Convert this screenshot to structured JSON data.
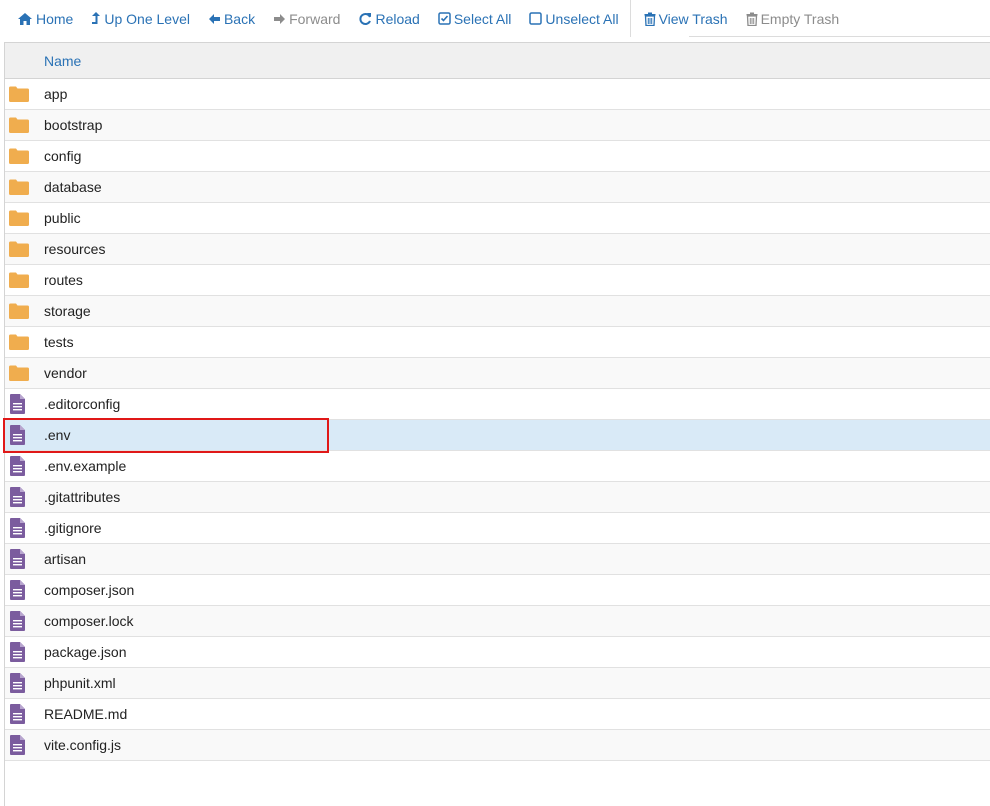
{
  "toolbar": {
    "buttons": [
      {
        "id": "home",
        "label": "Home",
        "icon": "home-icon",
        "enabled": true
      },
      {
        "id": "up",
        "label": "Up One Level",
        "icon": "level-up-icon",
        "enabled": true
      },
      {
        "id": "back",
        "label": "Back",
        "icon": "arrow-left-icon",
        "enabled": true
      },
      {
        "id": "forward",
        "label": "Forward",
        "icon": "arrow-right-icon",
        "enabled": false
      },
      {
        "id": "reload",
        "label": "Reload",
        "icon": "reload-icon",
        "enabled": true
      },
      {
        "id": "select_all",
        "label": "Select All",
        "icon": "checked-checkbox-icon",
        "enabled": true
      },
      {
        "id": "unselect_all",
        "label": "Unselect All",
        "icon": "empty-checkbox-icon",
        "enabled": true
      },
      {
        "id": "view_trash",
        "label": "View Trash",
        "icon": "trash-icon",
        "enabled": true
      },
      {
        "id": "empty_trash",
        "label": "Empty Trash",
        "icon": "trash-icon",
        "enabled": false
      }
    ]
  },
  "file_list": {
    "column_name": "Name",
    "items": [
      {
        "name": "app",
        "type": "folder"
      },
      {
        "name": "bootstrap",
        "type": "folder"
      },
      {
        "name": "config",
        "type": "folder"
      },
      {
        "name": "database",
        "type": "folder"
      },
      {
        "name": "public",
        "type": "folder"
      },
      {
        "name": "resources",
        "type": "folder"
      },
      {
        "name": "routes",
        "type": "folder"
      },
      {
        "name": "storage",
        "type": "folder"
      },
      {
        "name": "tests",
        "type": "folder"
      },
      {
        "name": "vendor",
        "type": "folder"
      },
      {
        "name": ".editorconfig",
        "type": "file"
      },
      {
        "name": ".env",
        "type": "file",
        "selected": true
      },
      {
        "name": ".env.example",
        "type": "file"
      },
      {
        "name": ".gitattributes",
        "type": "file"
      },
      {
        "name": ".gitignore",
        "type": "file"
      },
      {
        "name": "artisan",
        "type": "file"
      },
      {
        "name": "composer.json",
        "type": "file"
      },
      {
        "name": "composer.lock",
        "type": "file"
      },
      {
        "name": "package.json",
        "type": "file"
      },
      {
        "name": "phpunit.xml",
        "type": "file"
      },
      {
        "name": "README.md",
        "type": "file"
      },
      {
        "name": "vite.config.js",
        "type": "file"
      }
    ]
  },
  "colors": {
    "link_blue": "#2a72b5",
    "disabled_gray": "#8c8c8c",
    "folder_orange": "#f0ad4e",
    "file_purple": "#7b5c9e",
    "selected_row": "#d9eaf7",
    "highlight_red": "#e01818"
  }
}
